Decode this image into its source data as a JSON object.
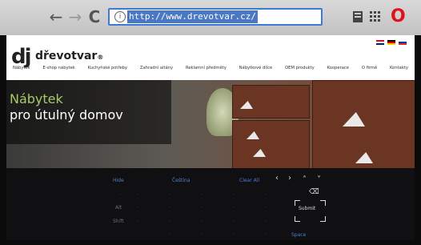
{
  "browser": {
    "url": "http://www.drevotvar.cz/",
    "buttons": {
      "back": "←",
      "forward": "→",
      "reload": "C"
    },
    "opera_logo": "O"
  },
  "site": {
    "logo_mark": "dj",
    "logo_name": "dřevotvar",
    "logo_suffix": "®",
    "nav": [
      "Nábytek",
      "E-shop nábytek",
      "Kuchyňské potřeby",
      "Zahradní altány",
      "Reklamní předměty",
      "Nábytkové dílce",
      "OEM produkty",
      "Kooperace",
      "O firmě",
      "Kontakty"
    ],
    "hero": {
      "line1": "Nábytek",
      "line2": "pro útulný domov"
    }
  },
  "keyboard": {
    "hide": "Hide",
    "language": "Čeština",
    "clear_all": "Clear All",
    "submit": "Submit",
    "space": "Space",
    "alt": "Alt",
    "shift": "Shift",
    "backspace": "⌫",
    "arrows": {
      "left": "‹",
      "right": "›",
      "up": "˄",
      "down": "˅"
    }
  },
  "colors": {
    "accent": "#4a78c2",
    "opera": "#e0101c",
    "hero_green": "#a9c96b"
  }
}
